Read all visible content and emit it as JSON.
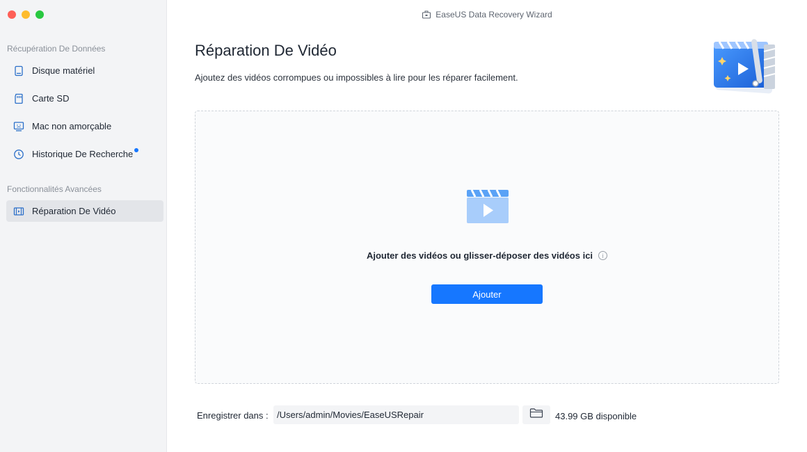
{
  "window": {
    "title": "EaseUS Data Recovery Wizard",
    "app_icon": "briefcase-icon"
  },
  "sidebar": {
    "sections": [
      {
        "title": "Récupération De Données",
        "items": [
          {
            "label": "Disque matériel",
            "icon": "hard-drive-icon"
          },
          {
            "label": "Carte SD",
            "icon": "sd-card-icon"
          },
          {
            "label": "Mac non amorçable",
            "icon": "monitor-icon"
          },
          {
            "label": "Historique De Recherche",
            "icon": "history-icon",
            "badge": true
          }
        ]
      },
      {
        "title": "Fonctionnalités Avancées",
        "items": [
          {
            "label": "Réparation De Vidéo",
            "icon": "film-icon",
            "active": true
          }
        ]
      }
    ]
  },
  "main": {
    "title": "Réparation De Vidéo",
    "subtitle": "Ajoutez des vidéos corrompues ou impossibles à lire pour les réparer facilement.",
    "dropzone": {
      "text": "Ajouter des vidéos ou glisser-déposer des vidéos ici",
      "info_glyph": "i",
      "button_label": "Ajouter"
    },
    "footer": {
      "save_label": "Enregistrer dans :",
      "path_value": "/Users/admin/Movies/EaseUSRepair",
      "free_space": "43.99 GB disponible"
    }
  },
  "colors": {
    "accent": "#1677ff",
    "sidebar_bg": "#f3f4f6",
    "close": "#fe5f57",
    "minimize": "#febc2e",
    "zoom": "#28c840"
  }
}
